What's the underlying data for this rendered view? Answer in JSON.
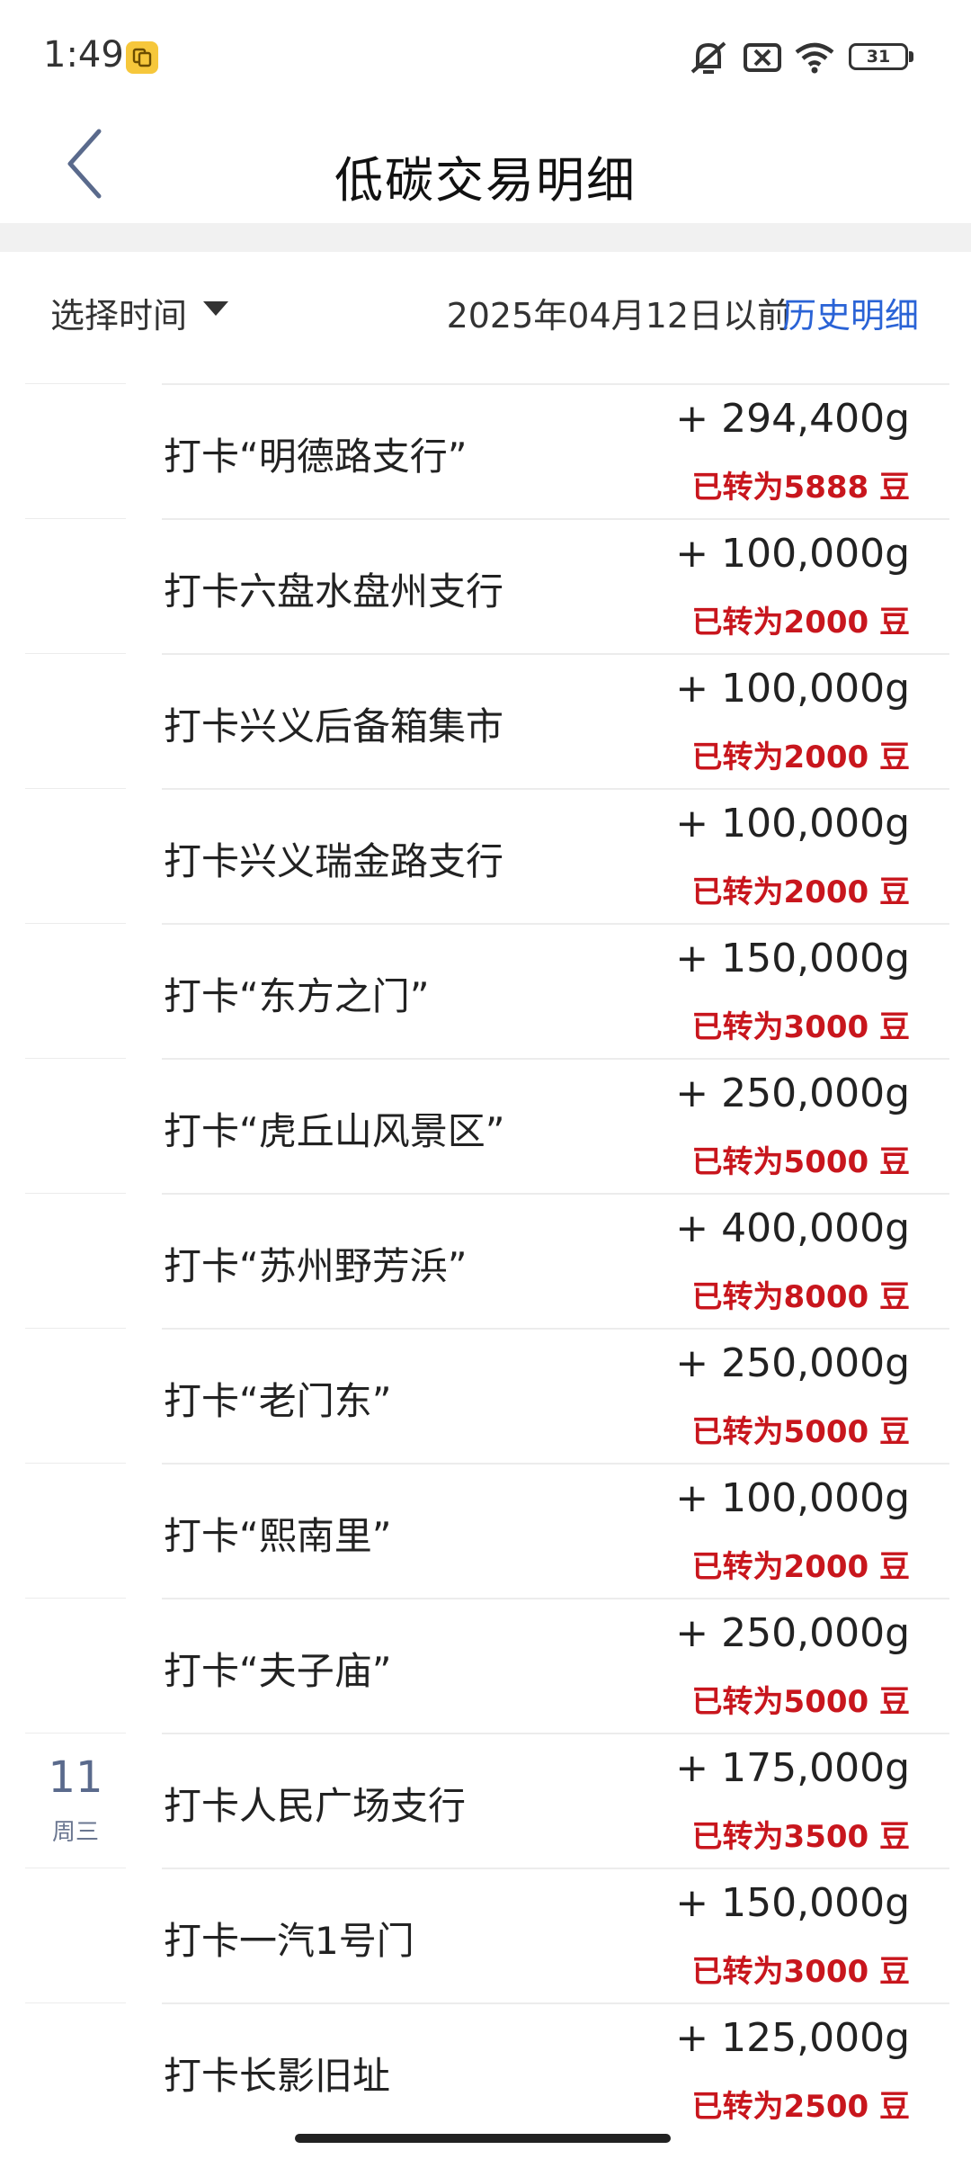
{
  "status_bar": {
    "time": "1:49",
    "battery": "31",
    "icons": [
      "app-notification-icon",
      "mute-icon",
      "no-sim-icon",
      "wifi-icon",
      "battery-icon"
    ]
  },
  "header": {
    "title": "低碳交易明细",
    "back_icon": "chevron-left-icon"
  },
  "filter": {
    "select_label": "选择时间",
    "date_text": "2025年04月12日以前",
    "history_link": "历史明细"
  },
  "colors": {
    "accent_blue": "#2a63d6",
    "bean_red": "#c8161d",
    "date_gray_blue": "#5a6a8c",
    "app_badge": "#f6c73b"
  },
  "transactions": [
    {
      "name": "打卡“明德路支行”",
      "amount": "+ 294,400g",
      "bean": "已转为5888 豆"
    },
    {
      "name": "打卡六盘水盘州支行",
      "amount": "+ 100,000g",
      "bean": "已转为2000 豆"
    },
    {
      "name": "打卡兴义后备箱集市",
      "amount": "+ 100,000g",
      "bean": "已转为2000 豆"
    },
    {
      "name": "打卡兴义瑞金路支行",
      "amount": "+ 100,000g",
      "bean": "已转为2000 豆"
    },
    {
      "name": "打卡“东方之门”",
      "amount": "+ 150,000g",
      "bean": "已转为3000 豆"
    },
    {
      "name": "打卡“虎丘山风景区”",
      "amount": "+ 250,000g",
      "bean": "已转为5000 豆"
    },
    {
      "name": "打卡“苏州野芳浜”",
      "amount": "+ 400,000g",
      "bean": "已转为8000 豆"
    },
    {
      "name": "打卡“老门东”",
      "amount": "+ 250,000g",
      "bean": "已转为5000 豆"
    },
    {
      "name": "打卡“熙南里”",
      "amount": "+ 100,000g",
      "bean": "已转为2000 豆"
    },
    {
      "name": "打卡“夫子庙”",
      "amount": "+ 250,000g",
      "bean": "已转为5000 豆"
    },
    {
      "name": "打卡人民广场支行",
      "amount": "+ 175,000g",
      "bean": "已转为3500 豆",
      "day": "11",
      "weekday": "周三"
    },
    {
      "name": "打卡一汽1号门",
      "amount": "+ 150,000g",
      "bean": "已转为3000 豆"
    },
    {
      "name": "打卡长影旧址",
      "amount": "+ 125,000g",
      "bean": "已转为2500 豆"
    }
  ]
}
